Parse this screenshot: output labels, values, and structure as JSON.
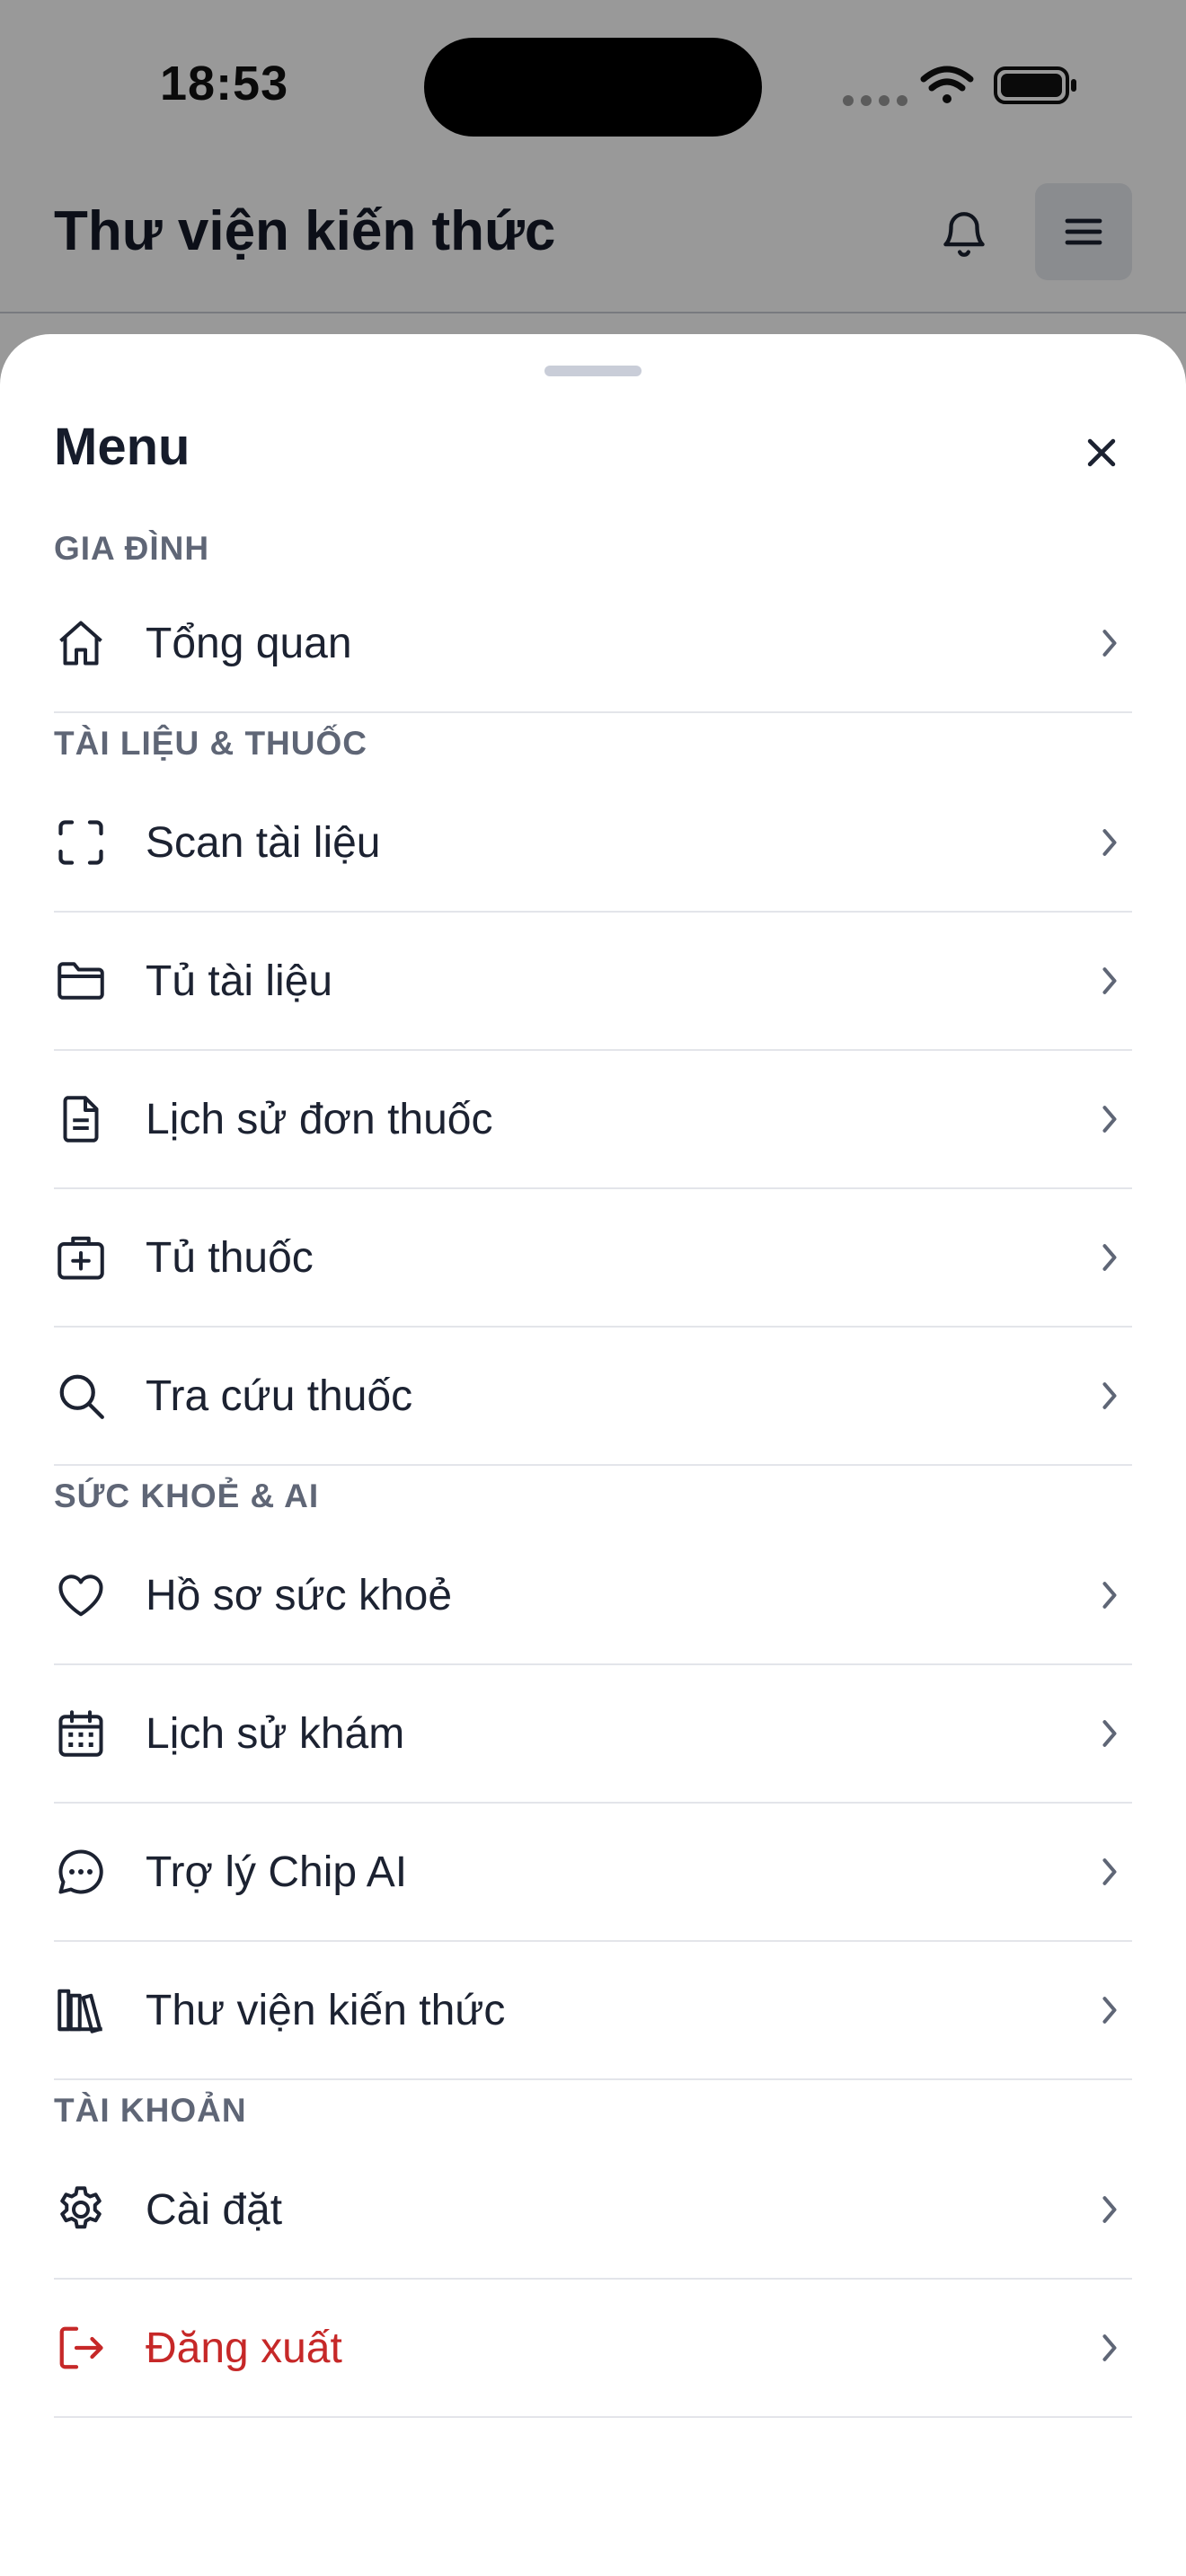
{
  "status_bar": {
    "time": "18:53"
  },
  "header": {
    "title": "Thư viện kiến thức"
  },
  "sheet": {
    "title": "Menu"
  },
  "sections": [
    {
      "label": "GIA ĐÌNH",
      "items": [
        {
          "label": "Tổng quan",
          "icon": "home-icon"
        }
      ]
    },
    {
      "label": "TÀI LIỆU & THUỐC",
      "items": [
        {
          "label": "Scan tài liệu",
          "icon": "scan-icon"
        },
        {
          "label": "Tủ tài liệu",
          "icon": "folder-icon"
        },
        {
          "label": "Lịch sử đơn thuốc",
          "icon": "document-icon"
        },
        {
          "label": "Tủ thuốc",
          "icon": "medicine-box-icon"
        },
        {
          "label": "Tra cứu thuốc",
          "icon": "search-icon"
        }
      ]
    },
    {
      "label": "SỨC KHOẺ & AI",
      "items": [
        {
          "label": "Hồ sơ sức khoẻ",
          "icon": "heart-icon"
        },
        {
          "label": "Lịch sử khám",
          "icon": "calendar-icon"
        },
        {
          "label": "Trợ lý Chip AI",
          "icon": "chat-icon"
        },
        {
          "label": "Thư viện kiến thức",
          "icon": "library-icon"
        }
      ]
    },
    {
      "label": "TÀI KHOẢN",
      "items": [
        {
          "label": "Cài đặt",
          "icon": "gear-icon"
        },
        {
          "label": "Đăng xuất",
          "icon": "logout-icon"
        }
      ]
    }
  ],
  "colors": {
    "danger": "#c62828",
    "text": "#1c2231",
    "section": "#5f6676"
  }
}
